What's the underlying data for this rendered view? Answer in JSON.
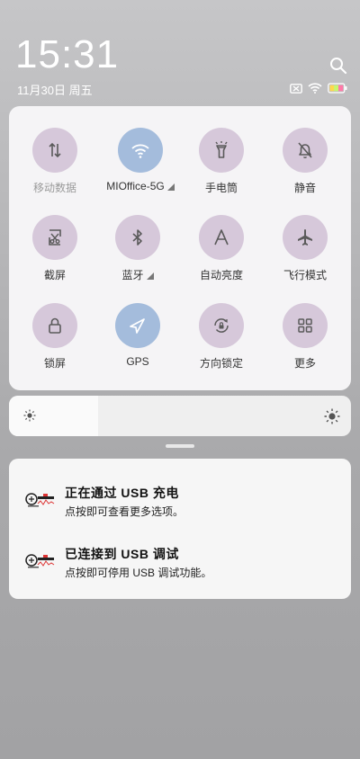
{
  "status_bar": {
    "time": "15:31",
    "date": "11月30日 周五",
    "icons": [
      "search-icon",
      "sim-blocked-icon",
      "wifi-icon",
      "battery-charging-icon"
    ]
  },
  "quick_settings": {
    "tiles": [
      {
        "label": "移动数据",
        "icon": "mobile-data-icon",
        "active": false,
        "dim": true
      },
      {
        "label": "MIOffice-5G",
        "icon": "wifi-icon",
        "active": true,
        "expand": true
      },
      {
        "label": "手电筒",
        "icon": "flashlight-icon",
        "active": false
      },
      {
        "label": "静音",
        "icon": "mute-icon",
        "active": false
      },
      {
        "label": "截屏",
        "icon": "screenshot-icon",
        "active": false
      },
      {
        "label": "蓝牙",
        "icon": "bluetooth-icon",
        "active": false,
        "expand": true
      },
      {
        "label": "自动亮度",
        "icon": "auto-brightness-icon",
        "active": false
      },
      {
        "label": "飞行模式",
        "icon": "airplane-icon",
        "active": false
      },
      {
        "label": "锁屏",
        "icon": "lock-icon",
        "active": false
      },
      {
        "label": "GPS",
        "icon": "gps-icon",
        "active": true
      },
      {
        "label": "方向锁定",
        "icon": "rotation-lock-icon",
        "active": false
      },
      {
        "label": "更多",
        "icon": "more-grid-icon",
        "active": false
      }
    ]
  },
  "brightness": {
    "level": 0.26
  },
  "notifications": [
    {
      "title": "正在通过 USB 充电",
      "text": "点按即可查看更多选项。",
      "icon": "app-logo-icon"
    },
    {
      "title": "已连接到 USB 调试",
      "text": "点按即可停用 USB 调试功能。",
      "icon": "app-logo-icon"
    }
  ],
  "colors": {
    "tile_off": "#d6c8da",
    "tile_on": "#a4bcdc",
    "icon": "#5a5a5a"
  }
}
